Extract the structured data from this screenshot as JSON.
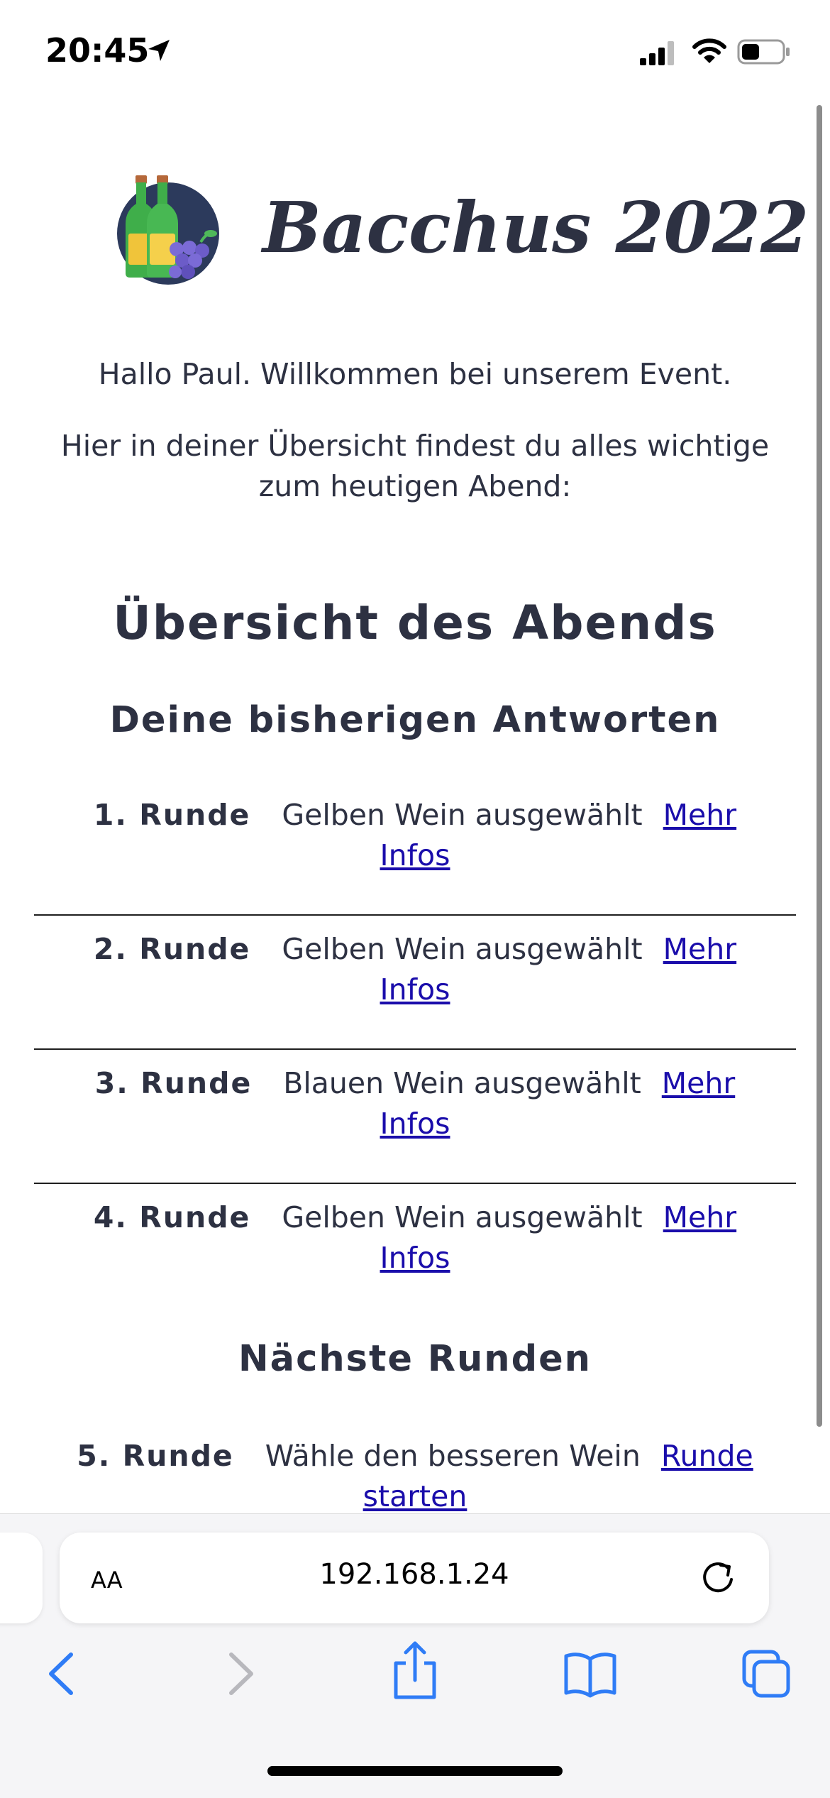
{
  "status_bar": {
    "time": "20:45",
    "location_icon": "location-arrow-icon",
    "signal_icon": "cellular-signal-icon",
    "wifi_icon": "wifi-icon",
    "battery_icon": "battery-icon",
    "battery_level": 0.45
  },
  "header": {
    "title": "Bacchus 2022",
    "logo_icon": "wine-bottles-grapes-icon"
  },
  "intro": {
    "greeting": "Hallo Paul. Willkommen bei unserem Event.",
    "description": "Hier in deiner Übersicht findest du alles wichtige zum heutigen Abend:"
  },
  "overview": {
    "title": "Übersicht des Abends",
    "answers_title": "Deine bisherigen Antworten",
    "answers": [
      {
        "round": "1. Runde",
        "answer": "Gelben Wein ausgewählt",
        "link": "Mehr Infos"
      },
      {
        "round": "2. Runde",
        "answer": "Gelben Wein ausgewählt",
        "link": "Mehr Infos"
      },
      {
        "round": "3. Runde",
        "answer": "Blauen Wein ausgewählt",
        "link": "Mehr Infos"
      },
      {
        "round": "4. Runde",
        "answer": "Gelben Wein ausgewählt",
        "link": "Mehr Infos"
      }
    ],
    "next_title": "Nächste Runden",
    "next_rounds": [
      {
        "round": "5. Runde",
        "text": "Wähle den besseren Wein",
        "link": "Runde starten"
      }
    ]
  },
  "browser": {
    "aa_label": "AA",
    "url": "192.168.1.24",
    "toolbar": [
      "back-icon",
      "forward-icon",
      "share-icon",
      "bookmarks-icon",
      "tabs-icon"
    ]
  },
  "colors": {
    "text": "#2d3142",
    "link": "#1a0dab",
    "ios_blue": "#2f7cf6",
    "chrome_bg": "#f5f5f7"
  }
}
